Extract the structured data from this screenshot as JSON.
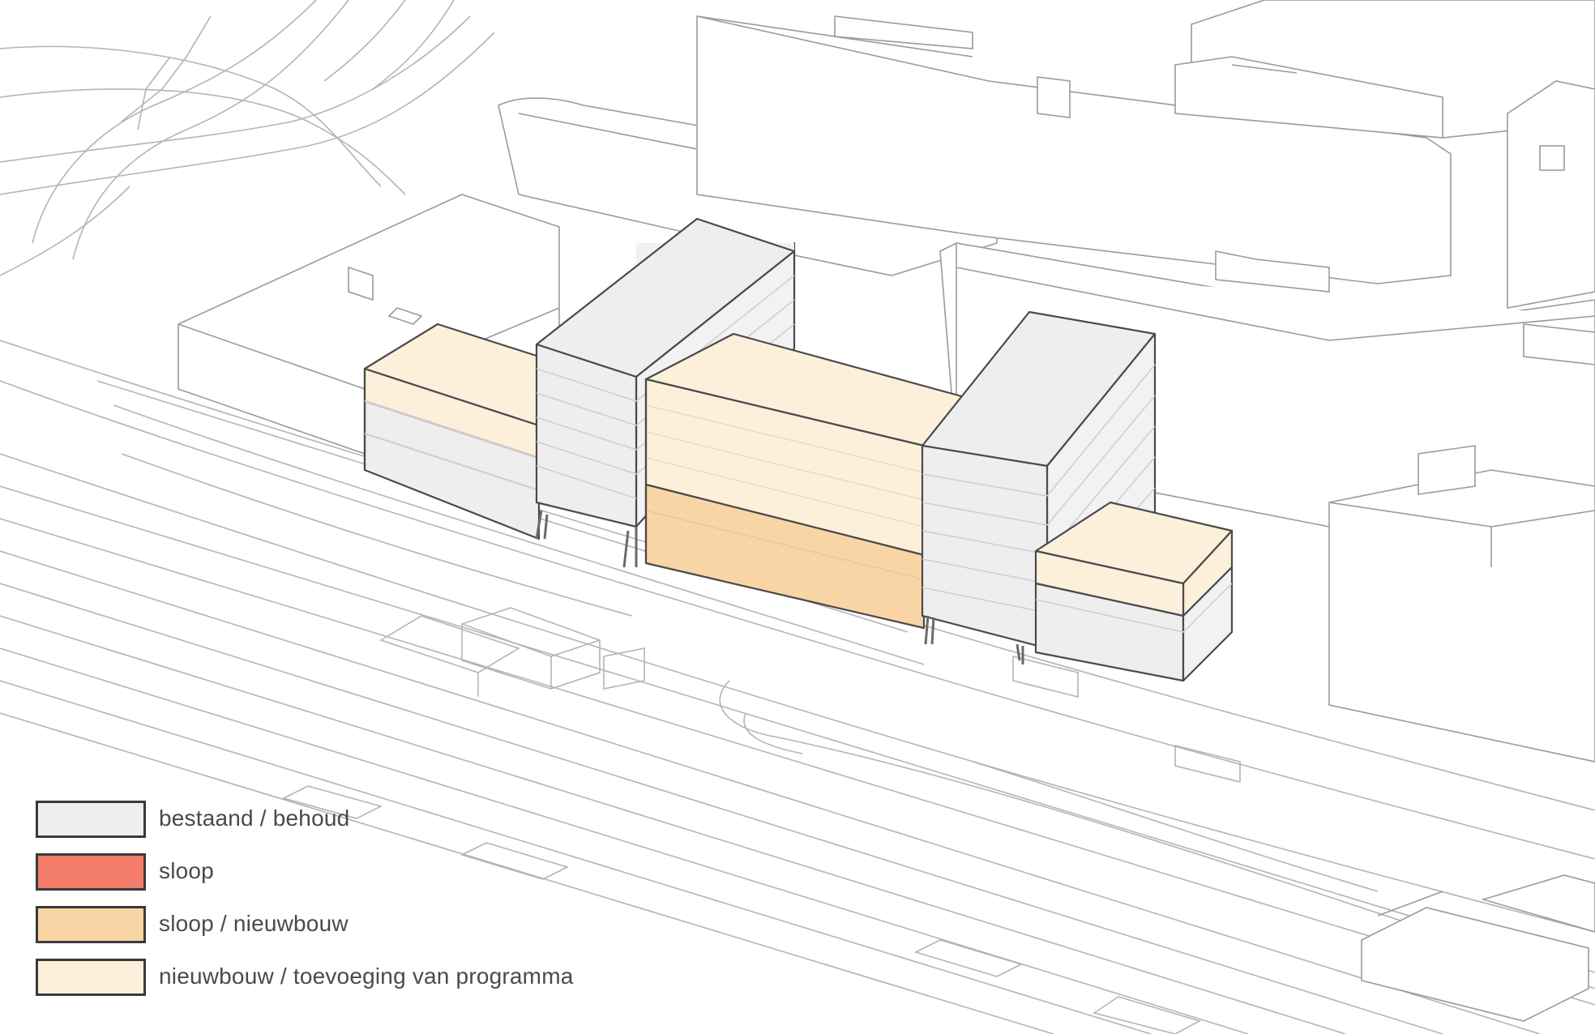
{
  "legend": {
    "items": [
      {
        "key": "existing",
        "label": "bestaand / behoud",
        "color": "#eeeeee"
      },
      {
        "key": "demolition",
        "label": "sloop",
        "color": "#f47c6a"
      },
      {
        "key": "demolition-new",
        "label": "sloop / nieuwbouw",
        "color": "#f9d5a6"
      },
      {
        "key": "new-addition",
        "label": "nieuwbouw / toevoeging van programma",
        "color": "#fdf0db"
      }
    ]
  },
  "colors": {
    "line": "#4a4a4a",
    "context_line": "#a9a9a9",
    "background": "#ffffff"
  }
}
